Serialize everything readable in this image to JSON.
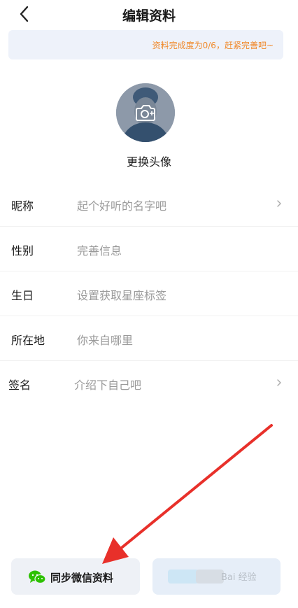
{
  "header": {
    "title": "编辑资料"
  },
  "progress": {
    "text": "资料完成度为0/6，赶紧完善吧~",
    "color": "#f08a2c"
  },
  "avatar": {
    "label": "更换头像"
  },
  "form": {
    "rows": [
      {
        "label": "昵称",
        "value": "起个好听的名字吧",
        "has_chevron": true
      },
      {
        "label": "性别",
        "value": "完善信息",
        "has_chevron": false
      },
      {
        "label": "生日",
        "value": "设置获取星座标签",
        "has_chevron": false
      },
      {
        "label": "所在地",
        "value": "你来自哪里",
        "has_chevron": false
      },
      {
        "label": "签名",
        "value": "介绍下自己吧",
        "has_chevron": true
      }
    ]
  },
  "bottom": {
    "sync_label": "同步微信资料",
    "watermark": "Bai 经验"
  },
  "icons": {
    "back": "chevron-left-icon",
    "camera": "camera-plus-icon",
    "wechat": "wechat-icon",
    "chevron": "chevron-right-icon"
  },
  "colors": {
    "accent": "#f08a2c",
    "wechat_green": "#2dc100",
    "annotation_arrow": "#e8302a"
  }
}
